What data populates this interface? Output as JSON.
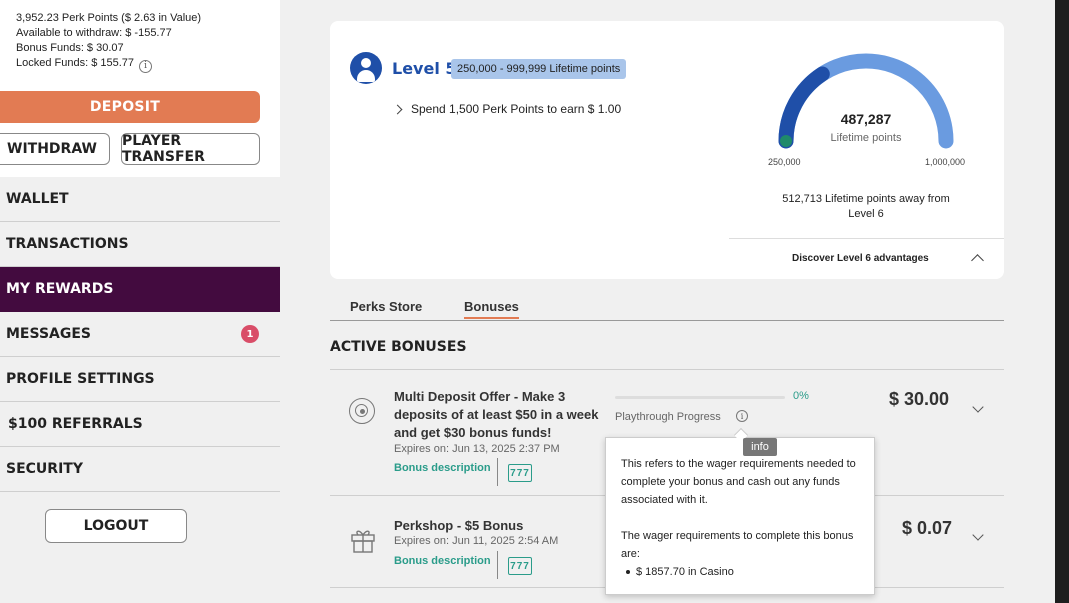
{
  "account": {
    "perk_points": "3,952.23 Perk Points ($ 2.63 in Value)",
    "available": "Available to withdraw: $ -155.77",
    "bonus_funds": "Bonus Funds: $ 30.07",
    "locked_funds": "Locked Funds: $ 155.77"
  },
  "buttons": {
    "deposit": "DEPOSIT",
    "withdraw": "WITHDRAW",
    "player_transfer": "PLAYER TRANSFER",
    "logout": "LOGOUT"
  },
  "nav": {
    "items": [
      {
        "label": "WALLET"
      },
      {
        "label": "TRANSACTIONS"
      },
      {
        "label": "MY REWARDS",
        "active": true
      },
      {
        "label": "MESSAGES",
        "badge": "1"
      },
      {
        "label": "PROFILE SETTINGS"
      },
      {
        "label": "$100 REFERRALS"
      },
      {
        "label": "SECURITY"
      }
    ]
  },
  "level": {
    "title": "Level 5",
    "range": "250,000 - 999,999 Lifetime points",
    "spend_text": "Spend 1,500 Perk Points to earn $ 1.00",
    "gauge_value": "487,287",
    "gauge_label": "Lifetime points",
    "gauge_min": "250,000",
    "gauge_max": "1,000,000",
    "gauge_progress": 0.316,
    "away_text": "512,713 Lifetime points away from Level 6",
    "discover": "Discover Level 6 advantages"
  },
  "tabs": [
    {
      "label": "Perks Store",
      "active": false
    },
    {
      "label": "Bonuses",
      "active": true
    }
  ],
  "section_title": "ACTIVE BONUSES",
  "bonuses": [
    {
      "icon": "target-icon",
      "title": "Multi Deposit Offer - Make 3 deposits of at least $50 in a week and get $30 bonus funds!",
      "expires": "Expires on: Jun 13, 2025 2:37 PM",
      "desc_link": "Bonus description",
      "progress_pct": "0%",
      "progress_label": "Playthrough Progress",
      "amount": "$ 30.00"
    },
    {
      "icon": "gift-icon",
      "title": "Perkshop - $5 Bonus",
      "expires": "Expires on: Jun 11, 2025 2:54 AM",
      "desc_link": "Bonus description",
      "amount": "$ 0.07"
    }
  ],
  "tooltip": {
    "tag": "info",
    "para1": "This refers to the wager requirements needed to complete your bonus and cash out any funds associated with it.",
    "para2": "The wager requirements to complete this bonus are:",
    "item": "$ 1857.70 in Casino"
  },
  "colors": {
    "accent_orange": "#e27b53",
    "nav_active": "#430b3f",
    "level_blue": "#1f4fa8",
    "gauge_light": "#6a9be0",
    "teal": "#2a9c8a",
    "badge_red": "#d94d68"
  }
}
